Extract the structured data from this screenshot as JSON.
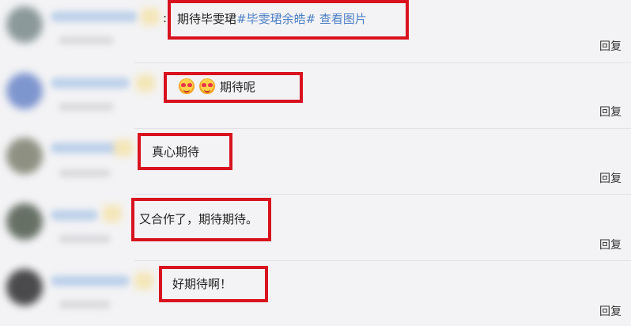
{
  "comments": [
    {
      "colon": ":",
      "text": "期待毕雯珺",
      "tag": "#毕雯珺余皓#",
      "extra": " 查看图片",
      "reply": "回复",
      "avatar_color": "#7a8a8c"
    },
    {
      "emoji_names": [
        "heart-eyes-emoji",
        "heart-eyes-emoji"
      ],
      "text": "期待呢",
      "reply": "回复",
      "avatar_color": "#6a86c8"
    },
    {
      "text": "真心期待",
      "reply": "回复",
      "avatar_color": "#7d806f"
    },
    {
      "text": "又合作了，期待期待。",
      "reply": "回复",
      "avatar_color": "#4f5a4d"
    },
    {
      "text": "好期待啊！",
      "reply": "回复",
      "avatar_color": "#2d2d30"
    }
  ],
  "colors": {
    "highlight_border": "#d8121f",
    "topic_link": "#4b7fc4",
    "background": "#f3f3f5"
  }
}
